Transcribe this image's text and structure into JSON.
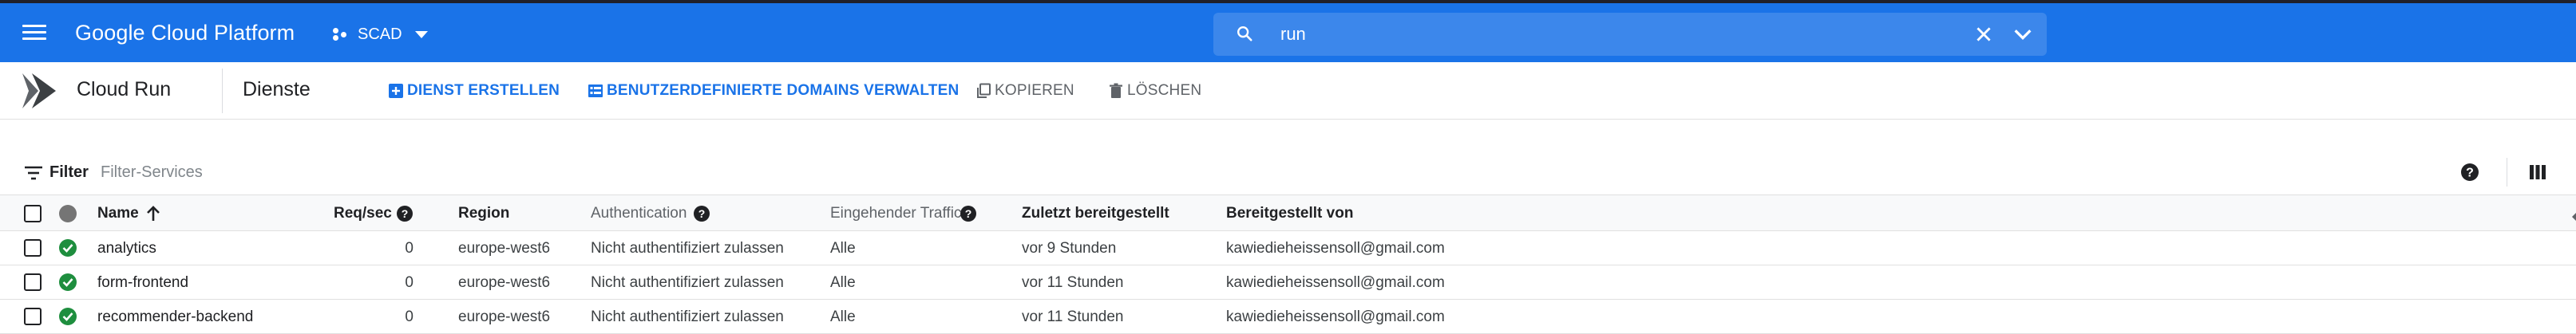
{
  "header": {
    "app_title": "Google Cloud Platform",
    "project_name": "SCAD",
    "accent_color": "#1a73e8",
    "icons": {
      "menu": "menu-icon",
      "project": "project-hierarchy-icon",
      "dropdown": "chevron-down-icon"
    }
  },
  "search": {
    "value": "run",
    "icons": {
      "search": "search-icon",
      "clear": "close-icon",
      "expand": "chevron-down-icon"
    }
  },
  "toolbar": {
    "product": "Cloud Run",
    "page_title": "Dienste",
    "create_label": "DIENST ERSTELLEN",
    "domains_label": "BENUTZERDEFINIERTE DOMAINS VERWALTEN",
    "copy_label": "KOPIEREN",
    "delete_label": "LÖSCHEN"
  },
  "filter": {
    "label": "Filter",
    "placeholder": "Filter-Services"
  },
  "table": {
    "columns": {
      "name": "Name",
      "req_sec": "Req/sec",
      "region": "Region",
      "authentication": "Authentication",
      "ingress": "Eingehender Traffic",
      "last_deployed": "Zuletzt bereitgestellt",
      "deployed_by": "Bereitgestellt von"
    },
    "rows": [
      {
        "name": "analytics",
        "req_sec": "0",
        "region": "europe-west6",
        "authentication": "Nicht authentifiziert zulassen",
        "ingress": "Alle",
        "last_deployed": "vor 9 Stunden",
        "deployed_by": "kawiedieheissensoll@gmail.com"
      },
      {
        "name": "form-frontend",
        "req_sec": "0",
        "region": "europe-west6",
        "authentication": "Nicht authentifiziert zulassen",
        "ingress": "Alle",
        "last_deployed": "vor 11 Stunden",
        "deployed_by": "kawiedieheissensoll@gmail.com"
      },
      {
        "name": "recommender-backend",
        "req_sec": "0",
        "region": "europe-west6",
        "authentication": "Nicht authentifiziert zulassen",
        "ingress": "Alle",
        "last_deployed": "vor 11 Stunden",
        "deployed_by": "kawiedieheissensoll@gmail.com"
      }
    ]
  }
}
